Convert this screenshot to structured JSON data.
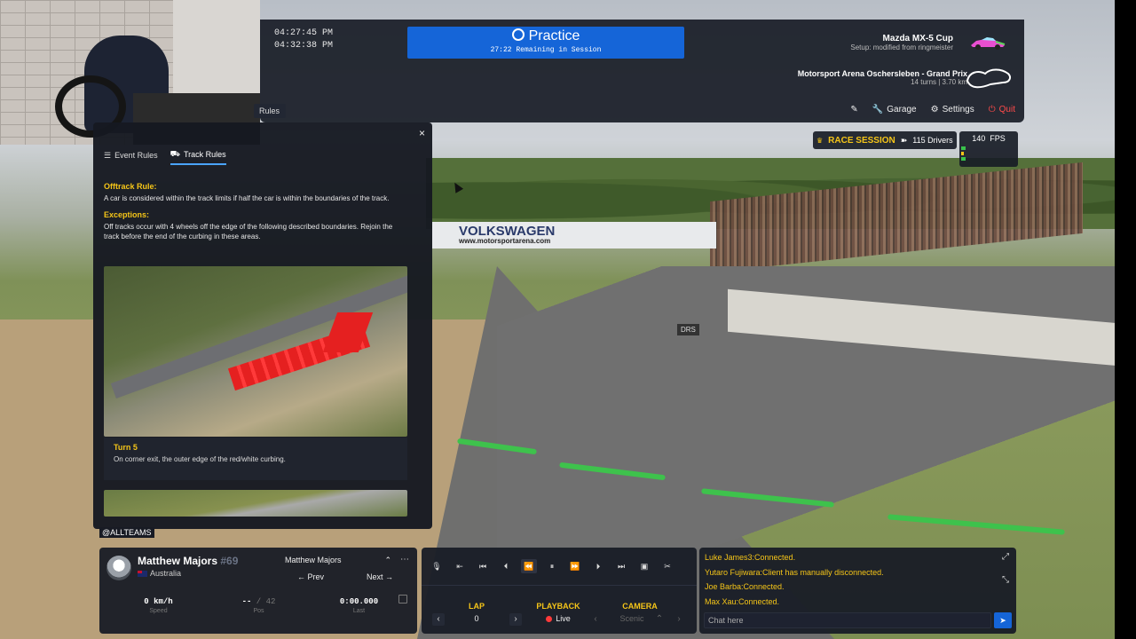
{
  "session": {
    "clock_local": "04:27:45 PM",
    "clock_sim": "04:32:38 PM",
    "title": "Practice",
    "remaining": "27:22 Remaining in Session"
  },
  "car": {
    "name": "Mazda MX-5 Cup",
    "setup": "Setup: modified from ringmeister"
  },
  "track": {
    "name": "Motorsport Arena Oschersleben - Grand Prix",
    "details": "14 turns  |  3.70 km"
  },
  "menu": {
    "garage": "Garage",
    "settings": "Settings",
    "quit": "Quit"
  },
  "rules_tab_label": "Rules",
  "race_session": {
    "label": "RACE SESSION",
    "drivers": "115 Drivers"
  },
  "fps": {
    "value": "140",
    "label": "FPS",
    "graph_letters": "L\nQ\nE"
  },
  "rules_panel": {
    "close": "×",
    "tabs": [
      "Event Rules",
      "Track Rules"
    ],
    "active_tab": "Track Rules",
    "offtrack_heading": "Offtrack Rule:",
    "offtrack_text": "A car is considered within the track limits if half the car is within the boundaries of the track.",
    "exceptions_heading": "Exceptions:",
    "exceptions_text": "Off tracks occur with 4 wheels off the edge of the following described boundaries. Rejoin the track before the end of the curbing in these areas.",
    "turn_title": "Turn 5",
    "turn_desc": "On corner exit, the outer edge of the red/white curbing."
  },
  "overlay_tag": "@ALLTEAMS",
  "scene": {
    "banner_brand": "VOLKSWAGEN",
    "banner_url": "www.motorsportarena.com",
    "drs_sign": "DRS"
  },
  "driver": {
    "name": "Matthew Majors",
    "number": "#69",
    "country": "Australia",
    "selected": "Matthew Majors",
    "prev": "Prev",
    "next": "Next",
    "speed_value": "0 km/h",
    "speed_label": "Speed",
    "pos_value": "--",
    "pos_total": "/ 42",
    "pos_label": "Pos",
    "last_value": "0:00.000",
    "last_label": "Last"
  },
  "playback": {
    "lap_label": "LAP",
    "lap_value": "0",
    "playback_label": "PLAYBACK",
    "playback_value": "Live",
    "camera_label": "CAMERA",
    "camera_value": "Scenic"
  },
  "chat": {
    "lines": [
      "Luke James3:Connected.",
      "Yutaro Fujiwara:Client has manually disconnected.",
      "Joe Barba:Connected.",
      "Max Xau:Connected."
    ],
    "placeholder": "Chat here"
  },
  "colors": {
    "accent_blue": "#1565d8",
    "highlight_yellow": "#f5c518",
    "quit_red": "#ff4a4a",
    "panel_bg": "#161921"
  }
}
